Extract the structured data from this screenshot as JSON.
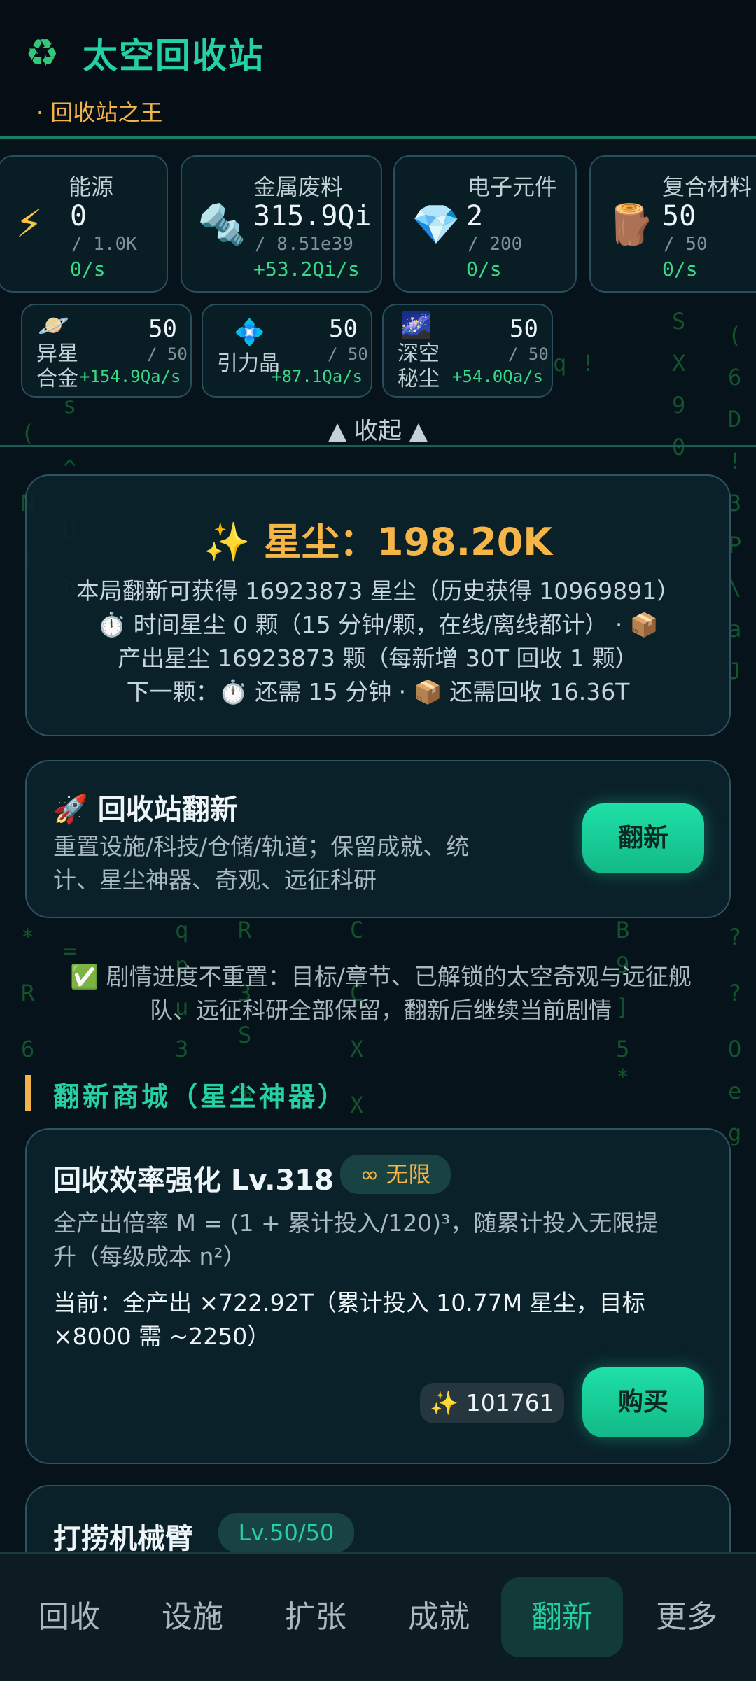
{
  "app": {
    "logo_icon": "recycle-icon",
    "title": "太空回收站",
    "subtitle": "· 回收站之王"
  },
  "resources": [
    {
      "name": "能源",
      "icon": "lightning-icon",
      "value": "0",
      "max": "/ 1.0K",
      "rate": "0/s"
    },
    {
      "name": "金属废料",
      "icon": "bolt-nut-icon",
      "value": "315.9Qi",
      "max": "/ 8.51e39",
      "rate": "+53.2Qi/s"
    },
    {
      "name": "电子元件",
      "icon": "gem-icon",
      "value": "2",
      "max": "/ 200",
      "rate": "0/s"
    },
    {
      "name": "复合材料",
      "icon": "wood-log-icon",
      "value": "50",
      "max": "/ 50",
      "rate": "0/s"
    }
  ],
  "special_resources": [
    {
      "name_line1": "异星",
      "name_line2": "合金",
      "icon": "planet-icon",
      "value": "50",
      "max": "/ 50",
      "rate": "+154.9Qa/s"
    },
    {
      "name_line1": "引力晶",
      "name_line2": "",
      "icon": "crystal-icon",
      "value": "50",
      "max": "/ 50",
      "rate": "+87.1Qa/s"
    },
    {
      "name_line1": "深空",
      "name_line2": "秘尘",
      "icon": "galaxy-icon",
      "value": "50",
      "max": "/ 50",
      "rate": "+54.0Qa/s"
    }
  ],
  "collapse_label": "▲ 收起 ▲",
  "stardust": {
    "title": "✨ 星尘：198.20K",
    "line1": "本局翻新可获得 16923873 星尘（历史获得 10969891）",
    "line2": "⏱️ 时间星尘 0 颗（15 分钟/颗，在线/离线都计） · 📦",
    "line3": "产出星尘 16923873 颗（每新增 30T 回收 1 颗）",
    "line4": "下一颗：⏱️ 还需 15 分钟 · 📦 还需回收 16.36T"
  },
  "renovate": {
    "title": "🚀 回收站翻新",
    "desc_line1": "重置设施/科技/仓储/轨道；保留成就、统",
    "desc_line2": "计、星尘神器、奇观、远征科研",
    "button": "翻新"
  },
  "notice": {
    "line1": "✅ 剧情进度不重置：目标/章节、已解锁的太空奇观与远征舰",
    "line2": "队、远征科研全部保留，翻新后继续当前剧情"
  },
  "shop": {
    "title": "翻新商城（星尘神器）",
    "item1": {
      "name": "回收效率强化 Lv.318",
      "badge": "∞ 无限",
      "desc_line1": "全产出倍率 M = (1 + 累计投入/120)³，随累计投入无限提",
      "desc_line2": "升（每级成本 n²）",
      "current_line1": "当前：全产出 ×722.92T（累计投入 10.77M 星尘，目标",
      "current_line2": "×8000 需 ~2250）",
      "cost": "✨ 101761",
      "button": "购买"
    },
    "item2": {
      "name": "打捞机械臂",
      "badge": "Lv.50/50"
    }
  },
  "nav": [
    "回收",
    "设施",
    "扩张",
    "成就",
    "翻新",
    "更多"
  ],
  "nav_active_index": 4,
  "colors": {
    "accent": "#22d0a0",
    "gold": "#f6b547",
    "rate_green": "#39d98a"
  }
}
